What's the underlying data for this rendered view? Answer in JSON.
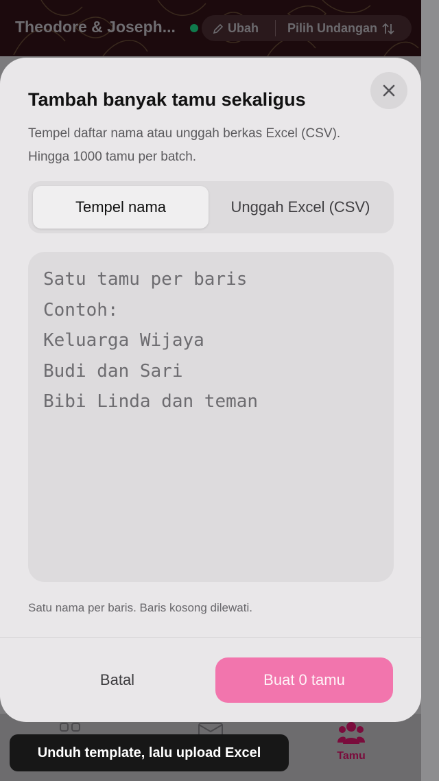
{
  "header": {
    "event_title": "Theodore & Joseph...",
    "edit_label": "Ubah",
    "select_invitation_label": "Pilih Undangan",
    "status_color": "#0f7a4c"
  },
  "modal": {
    "title": "Tambah banyak tamu sekaligus",
    "description_line1": "Tempel daftar nama atau unggah berkas Excel (CSV).",
    "description_line2": "Hingga 1000 tamu per batch.",
    "tabs": [
      {
        "label": "Tempel nama",
        "active": true
      },
      {
        "label": "Unggah Excel (CSV)",
        "active": false
      }
    ],
    "textarea": {
      "value": "",
      "placeholder": "Satu tamu per baris\nContoh:\nKeluarga Wijaya\nBudi dan Sari\nBibi Linda dan teman"
    },
    "hint": "Satu nama per baris. Baris kosong dilewati.",
    "cancel_label": "Batal",
    "create_label": "Buat 0 tamu",
    "close_icon": "close-icon"
  },
  "bottom_nav": {
    "active_item": {
      "label": "Tamu",
      "icon": "guests-icon"
    }
  },
  "toast": {
    "message": "Unduh template, lalu upload Excel"
  },
  "colors": {
    "accent": "#f275ad",
    "nav_active": "#7a0c3c"
  }
}
